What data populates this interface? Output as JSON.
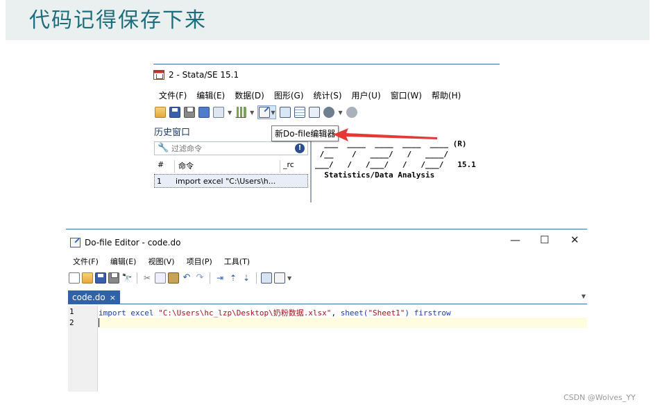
{
  "banner": {
    "title": "代码记得保存下来"
  },
  "stata": {
    "window_title": "2 - Stata/SE 15.1",
    "menu": [
      "文件(F)",
      "编辑(E)",
      "数据(D)",
      "图形(G)",
      "统计(S)",
      "用户(U)",
      "窗口(W)",
      "帮助(H)"
    ],
    "history_title": "历史窗口",
    "filter_placeholder": "过滤命令",
    "history_columns": [
      "#",
      "命令",
      "_rc"
    ],
    "history_rows": [
      {
        "num": "1",
        "command": "import excel \"C:\\Users\\h..."
      }
    ],
    "tooltip": "新Do-file编辑器",
    "results_lines": [
      "  ___  ____  ____  ____  ____ (R)",
      " /__    /   ____/   /   ____/",
      "___/   /   /___/   /   /___/   15.1",
      "  Statistics/Data Analysis"
    ]
  },
  "editor": {
    "window_title": "Do-file Editor - code.do",
    "window_controls": {
      "minimize": "—",
      "maximize": "☐",
      "close": "✕"
    },
    "menu": [
      "文件(F)",
      "编辑(E)",
      "视图(V)",
      "项目(P)",
      "工具(T)"
    ],
    "tab_label": "code.do",
    "tab_close": "×",
    "line_numbers": [
      "1",
      "2"
    ],
    "code": {
      "kw_import": "import",
      "kw_excel": "excel",
      "path": "\"C:\\Users\\hc_lzp\\Desktop\\奶粉数据.xlsx\"",
      "comma": ",",
      "kw_sheet": "sheet(",
      "sheet_name": "\"Sheet1\"",
      "close_paren": ")",
      "kw_firstrow": "firstrow"
    }
  },
  "watermark": "CSDN @Wolves_YY",
  "colors": {
    "banner_bg": "#e9f0ef",
    "banner_text": "#1d6d7c",
    "tab_bg": "#2f62a8",
    "arrow": "#e53935"
  }
}
